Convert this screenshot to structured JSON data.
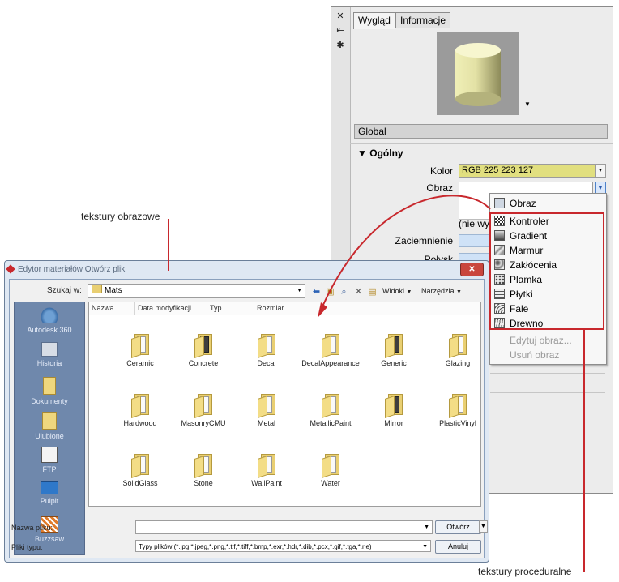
{
  "annotations": {
    "image_textures": "tekstury obrazowe",
    "procedural_textures": "tekstury proceduralne"
  },
  "colors": {
    "accent_red": "#c8282d",
    "kolor_swatch": "#e1df7f"
  },
  "palette": {
    "tabs": [
      "Wygląd",
      "Informacje"
    ],
    "global_label": "Global",
    "section_title": "Ogólny",
    "section_arrow": "▼",
    "kolor_label": "Kolor",
    "kolor_value": "RGB 225 223 127",
    "obraz_label": "Obraz",
    "nie_wy": "(nie wy",
    "zaciemnienie_label": "Zaciemnienie",
    "polysk_label": "Połysk"
  },
  "dropdown": {
    "header": "Obraz",
    "items": [
      "Kontroler",
      "Gradient",
      "Marmur",
      "Zakłócenia",
      "Plamka",
      "Płytki",
      "Fale",
      "Drewno"
    ],
    "disabled": [
      "Edytuj obraz...",
      "Usuń obraz"
    ]
  },
  "dialog": {
    "title": "Edytor materiałów Otwórz plik",
    "look_in_label": "Szukaj w:",
    "look_in_value": "Mats",
    "views_label": "Widoki",
    "tools_label": "Narzędzia",
    "columns": [
      "Nazwa",
      "Data modyfikacji",
      "Typ",
      "Rozmiar"
    ],
    "places": [
      "Autodesk 360",
      "Historia",
      "Dokumenty",
      "Ulubione",
      "FTP",
      "Pulpit",
      "Buzzsaw"
    ],
    "folders": [
      "Ceramic",
      "Concrete",
      "Decal",
      "DecalAppearance",
      "Generic",
      "Glazing",
      "Hardwood",
      "MasonryCMU",
      "Metal",
      "MetallicPaint",
      "Mirror",
      "PlasticVinyl",
      "SolidGlass",
      "Stone",
      "WallPaint",
      "Water"
    ],
    "filename_label": "Nazwa pliku:",
    "filetype_label": "Pliki typu:",
    "filetype_value": "Typy plików (*.jpg,*.jpeg,*.png,*.tif,*.tiff,*.bmp,*.exr,*.hdr,*.dib,*.pcx,*.gif,*.tga,*.rle)",
    "open_button": "Otwórz",
    "cancel_button": "Anuluj"
  }
}
